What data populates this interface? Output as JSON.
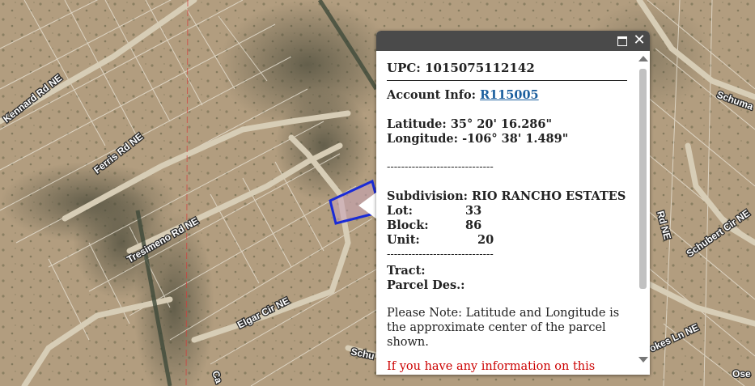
{
  "map": {
    "roads": [
      "Kennard Rd NE",
      "Ferris Rd NE",
      "Tresimeno Rd NE",
      "Elgar Cir NE",
      "Schu",
      "Ca",
      "Schuma",
      "Rd NE",
      "Schubert Cir NE",
      "okes Ln NE",
      "Ose"
    ],
    "parcel_color": "#1a2bd6"
  },
  "popup": {
    "maximize_icon": "maximize-icon",
    "close_icon": "close-icon",
    "upc_label": "UPC:",
    "upc_value": "1015075112142",
    "account_label": "Account Info:",
    "account_link": "R115005",
    "latitude_label": "Latitude:",
    "latitude_value": "35° 20' 16.286\"",
    "longitude_label": "Longitude:",
    "longitude_value": "-106° 38' 1.489\"",
    "divider": "------------------------------",
    "subdivision_label": "Subdivision:",
    "subdivision_value": "RIO RANCHO ESTATES",
    "lot_label": "Lot:",
    "lot_value": "33",
    "block_label": "Block:",
    "block_value": "86",
    "unit_label": "Unit:",
    "unit_value": "20",
    "tract_label": "Tract:",
    "parcel_des_label": "Parcel Des.:",
    "note": "Please Note: Latitude and Longitude is the approximate center of the parcel shown.",
    "red_text": "If you have any information on this"
  }
}
